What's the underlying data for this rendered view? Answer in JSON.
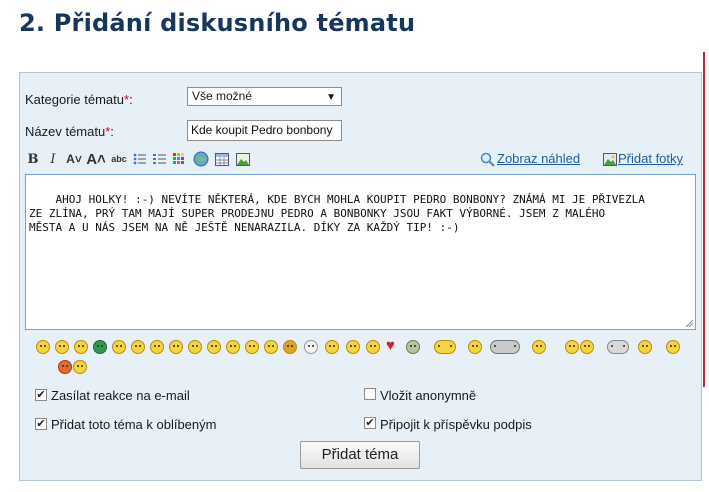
{
  "page_title": "2. Přidání diskusního tématu",
  "form": {
    "category_label": "Kategorie tématu",
    "category_value": "Vše možné",
    "topic_label": "Název tématu",
    "topic_value": "Kde koupit Pedro bonbony",
    "required_mark": "*",
    "colon": ":"
  },
  "toolbar": {
    "bold": "B",
    "italic": "I",
    "font_smaller": "A˅",
    "font_larger": "A˄",
    "small_caps": "abc",
    "preview_link": "Zobraz náhled",
    "add_photo_link": "Přidat fotky"
  },
  "message": "AHOJ HOLKY! :-) NEVÍTE NĚKTERÁ, KDE BYCH MOHLA KOUPIT PEDRO BONBONY? ZNÁMÁ MI JE PŘIVEZLA\nZE ZLÍNA, PRÝ TAM MAJÍ SUPER PRODEJNU PEDRO A BONBONKY JSOU FAKT VÝBORNÉ. JSEM Z MALÉHO\nMĚSTA A U NÁS JSEM NA NĚ JEŠTĚ NENARAZILA. DÍKY ZA KAŽDÝ TIP! :-)",
  "options": {
    "email": {
      "label": "Zasílat reakce na e-mail",
      "checked": true
    },
    "anonymous": {
      "label": "Vložit anonymně",
      "checked": false
    },
    "favorite": {
      "label": "Přidat toto téma k oblíbeným",
      "checked": true
    },
    "signature": {
      "label": "Připojit k příspěvku podpis",
      "checked": true
    }
  },
  "submit_label": "Přidat téma",
  "emoticon_count": 33
}
